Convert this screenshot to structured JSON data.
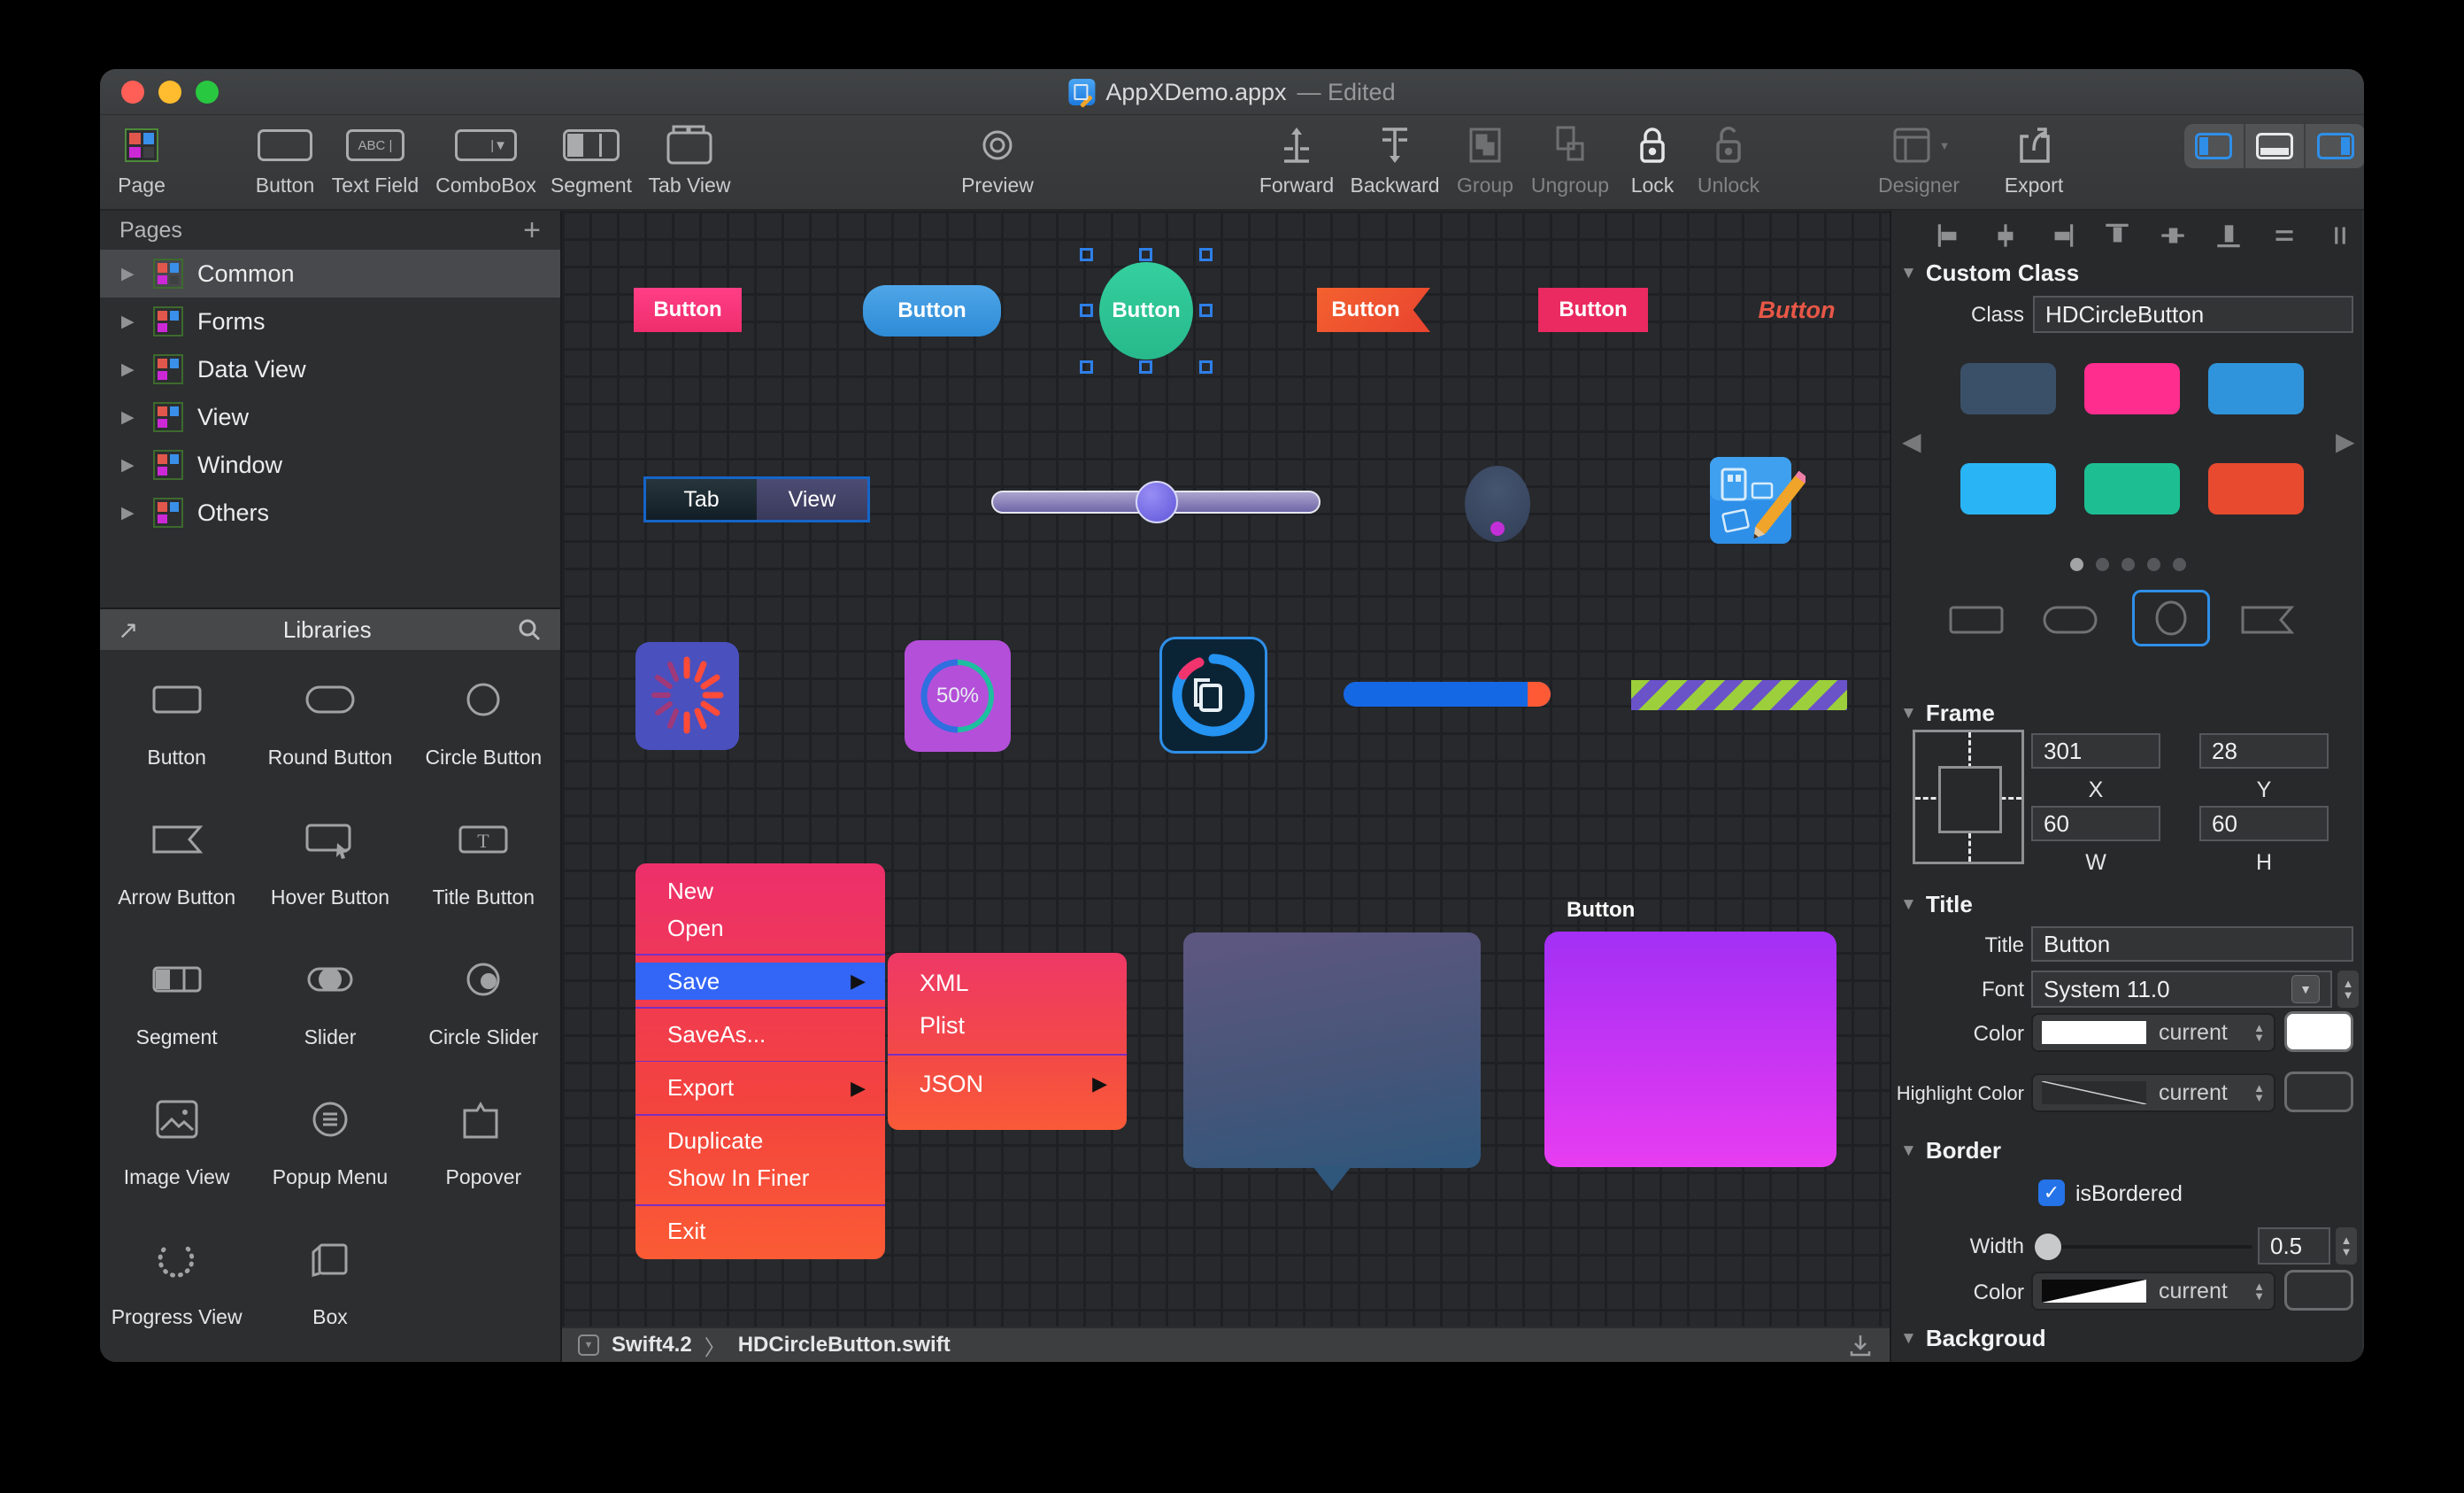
{
  "window": {
    "title": "AppXDemo.appx",
    "edited": "— Edited"
  },
  "toolbar": {
    "page": "Page",
    "button": "Button",
    "text_field": "Text Field",
    "combobox": "ComboBox",
    "segment": "Segment",
    "tab_view": "Tab View",
    "preview": "Preview",
    "forward": "Forward",
    "backward": "Backward",
    "group": "Group",
    "ungroup": "Ungroup",
    "lock": "Lock",
    "unlock": "Unlock",
    "designer": "Designer",
    "export": "Export",
    "text_field_glyph": "ABC |",
    "combobox_glyph": "|▼"
  },
  "pages": {
    "header": "Pages",
    "items": [
      {
        "label": "Common"
      },
      {
        "label": "Forms"
      },
      {
        "label": "Data View"
      },
      {
        "label": "View"
      },
      {
        "label": "Window"
      },
      {
        "label": "Others"
      }
    ]
  },
  "libraries": {
    "header": "Libraries",
    "items": [
      {
        "label": "Button"
      },
      {
        "label": "Round Button"
      },
      {
        "label": "Circle Button"
      },
      {
        "label": "Arrow Button"
      },
      {
        "label": "Hover Button"
      },
      {
        "label": "Title Button"
      },
      {
        "label": "Segment"
      },
      {
        "label": "Slider"
      },
      {
        "label": "Circle Slider"
      },
      {
        "label": "Image View"
      },
      {
        "label": "Popup Menu"
      },
      {
        "label": "Popover"
      },
      {
        "label": "Progress View"
      },
      {
        "label": "Box"
      }
    ]
  },
  "canvas": {
    "button_label": "Button",
    "segment": {
      "left": "Tab",
      "right": "View"
    },
    "progress_percent": "50%",
    "menu": {
      "items": [
        "New",
        "Open",
        "Save",
        "SaveAs...",
        "Export",
        "Duplicate",
        "Show In Finer",
        "Exit"
      ],
      "highlighted": "Save"
    },
    "submenu": {
      "items": [
        "XML",
        "Plist",
        "JSON"
      ]
    },
    "statusbar": {
      "language": "Swift4.2",
      "chevron": "〉",
      "file": "HDCircleButton.swift"
    }
  },
  "inspector": {
    "custom_class": {
      "header": "Custom Class",
      "class_label": "Class",
      "class_value": "HDCircleButton",
      "swatches": [
        "#3a5068",
        "#ff2d8e",
        "#2f94db",
        "#29b5f5",
        "#1dbf92",
        "#e84a2f"
      ]
    },
    "frame": {
      "header": "Frame",
      "x_value": "301",
      "y_value": "28",
      "w_value": "60",
      "h_value": "60",
      "x_label": "X",
      "y_label": "Y",
      "w_label": "W",
      "h_label": "H"
    },
    "title": {
      "header": "Title",
      "title_label": "Title",
      "title_value": "Button",
      "font_label": "Font",
      "font_value": "System 11.0",
      "color_label": "Color",
      "color_current": "current",
      "highlight_label": "Highlight Color",
      "highlight_current": "current",
      "color_value_hex": "#ffffff"
    },
    "border": {
      "header": "Border",
      "checkbox_label": "isBordered",
      "checked": "✓",
      "width_label": "Width",
      "width_value": "0.5",
      "color_label": "Color",
      "color_current": "current"
    },
    "background": {
      "header": "Backgroud"
    }
  },
  "colors": {
    "accent_blue": "#2f8fe8",
    "selection_handle": "#2f7fe8",
    "menu_highlight": "#3366f7"
  }
}
